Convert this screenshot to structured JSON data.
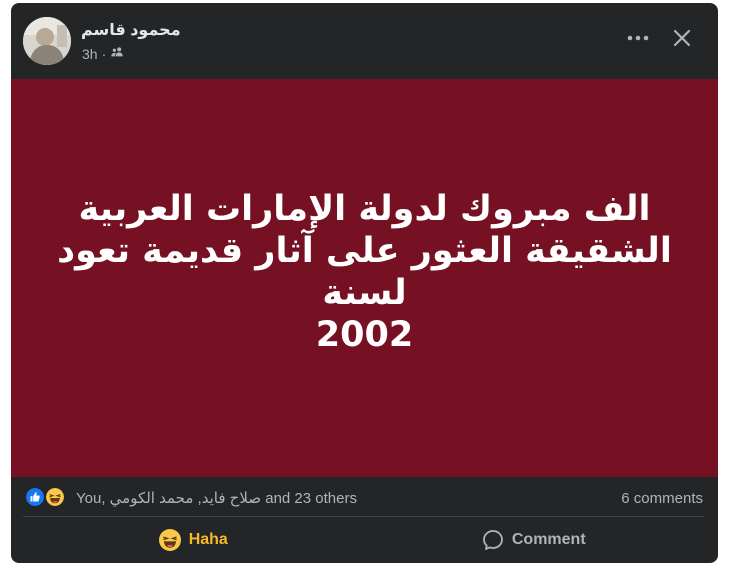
{
  "post": {
    "author": "محمود قاسم",
    "time": "3h",
    "separator": "·",
    "audience_icon": "friends-icon",
    "more_icon": "more-horizontal-icon",
    "close_icon": "close-icon",
    "media": {
      "background": "#751123",
      "lines": [
        "الف مبروك لدولة الإمارات العربية",
        "الشقيقة العثور على آثار قديمة تعود لسنة",
        "2002"
      ]
    },
    "reactions": {
      "icons": [
        "like-reaction-icon",
        "haha-reaction-icon"
      ],
      "names": "You, صلاح فايد, محمد الكومي and 23 others",
      "comments": "6 comments"
    },
    "actions": {
      "reaction_label": "Haha",
      "reaction_color": "#f7b928",
      "comment_label": "Comment"
    }
  }
}
